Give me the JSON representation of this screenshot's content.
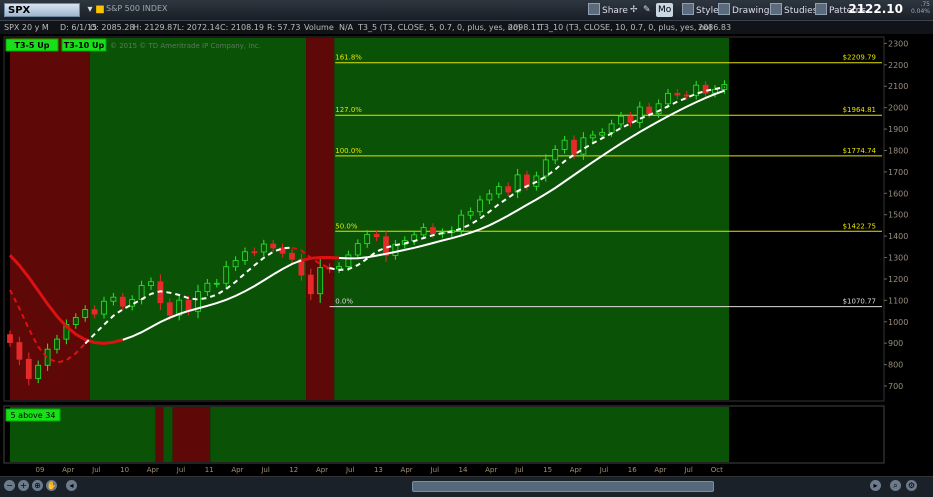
{
  "toolbar": {
    "symbol": "SPX",
    "index_name": "S&P 500 INDEX",
    "share_label": "Share",
    "mo_label": "Mo",
    "style_label": "Style",
    "drawings_label": "Drawings",
    "studies_label": "Studies",
    "patterns_label": "Patterns",
    "last_price": "2122.10",
    "change_top": ".75",
    "change_bottom": "0.04%"
  },
  "infobar": {
    "descriptor": "SPX 20 y M",
    "date": "D: 6/1/15",
    "open": "O: 2085.28",
    "high": "H: 2129.87",
    "low": "L: 2072.14",
    "close": "C: 2108.19",
    "range": "R: 57.73",
    "volume": "Volume",
    "na": "N/A",
    "t3_5": "T3_5 (T3, CLOSE, 5, 0.7, 0, plus, yes, no)",
    "t3_5_val": "2098.11",
    "t3_10": "T3_10 (T3, CLOSE, 10, 0.7, 0, plus, yes, no)",
    "t3_10_val": "2086.83"
  },
  "chart_data": {
    "type": "candlestick",
    "copyright": "© 2015 © TD Ameritrade IP Company, Inc.",
    "badges": [
      "T3-5 Up",
      "T3-10 Up"
    ],
    "lower_badge": "5 above 34",
    "y_ticks": [
      700,
      800,
      900,
      1000,
      1100,
      1200,
      1300,
      1400,
      1500,
      1600,
      1700,
      1800,
      1900,
      2000,
      2100,
      2200,
      2300
    ],
    "ylim": [
      630,
      2330
    ],
    "x_labels": [
      "09",
      "Apr",
      "Jul",
      "10",
      "Apr",
      "Jul",
      "11",
      "Apr",
      "Jul",
      "12",
      "Apr",
      "Jul",
      "13",
      "Apr",
      "Jul",
      "14",
      "Apr",
      "Jul",
      "15",
      "Apr",
      "Jul",
      "16",
      "Apr",
      "Jul",
      "Oct"
    ],
    "fibonacci": [
      {
        "label": "161.8%",
        "price_label": "$2209.79",
        "value": 2209.79
      },
      {
        "label": "127.0%",
        "price_label": "$1964.81",
        "value": 1964.81
      },
      {
        "label": "100.0%",
        "price_label": "$1774.74",
        "value": 1774.74
      },
      {
        "label": "50.0%",
        "price_label": "$1422.75",
        "value": 1422.75
      },
      {
        "label": "0.0%",
        "price_label": "$1070.77",
        "value": 1070.77
      }
    ],
    "closes": [
      903,
      825,
      735,
      797,
      872,
      919,
      987,
      1020,
      1057,
      1036,
      1096,
      1115,
      1073,
      1104,
      1169,
      1187,
      1089,
      1031,
      1101,
      1049,
      1141,
      1180,
      1180,
      1257,
      1286,
      1327,
      1326,
      1363,
      1345,
      1320,
      1292,
      1218,
      1131,
      1253,
      1247,
      1258,
      1312,
      1365,
      1408,
      1397,
      1310,
      1362,
      1379,
      1406,
      1440,
      1412,
      1416,
      1426,
      1498,
      1514,
      1569,
      1597,
      1631,
      1606,
      1686,
      1633,
      1681,
      1756,
      1805,
      1848,
      1783,
      1859,
      1872,
      1884,
      1924,
      1960,
      1931,
      2003,
      1972,
      2018,
      2067,
      2059,
      2058,
      2105,
      2068,
      2085,
      2108
    ],
    "regions": [
      {
        "color": "red",
        "from": 0,
        "to": 8.5
      },
      {
        "color": "green",
        "from": 8.5,
        "to": 31.5
      },
      {
        "color": "red",
        "from": 31.5,
        "to": 34.5
      },
      {
        "color": "green",
        "from": 34.5,
        "to": 76.5
      }
    ],
    "lower_regions": [
      {
        "color": "green",
        "from": 0,
        "to": 15.5
      },
      {
        "color": "red",
        "from": 15.5,
        "to": 16.3
      },
      {
        "color": "green",
        "from": 16.3,
        "to": 17.3
      },
      {
        "color": "red",
        "from": 17.3,
        "to": 21.3
      },
      {
        "color": "green",
        "from": 21.3,
        "to": 76.5
      }
    ]
  }
}
